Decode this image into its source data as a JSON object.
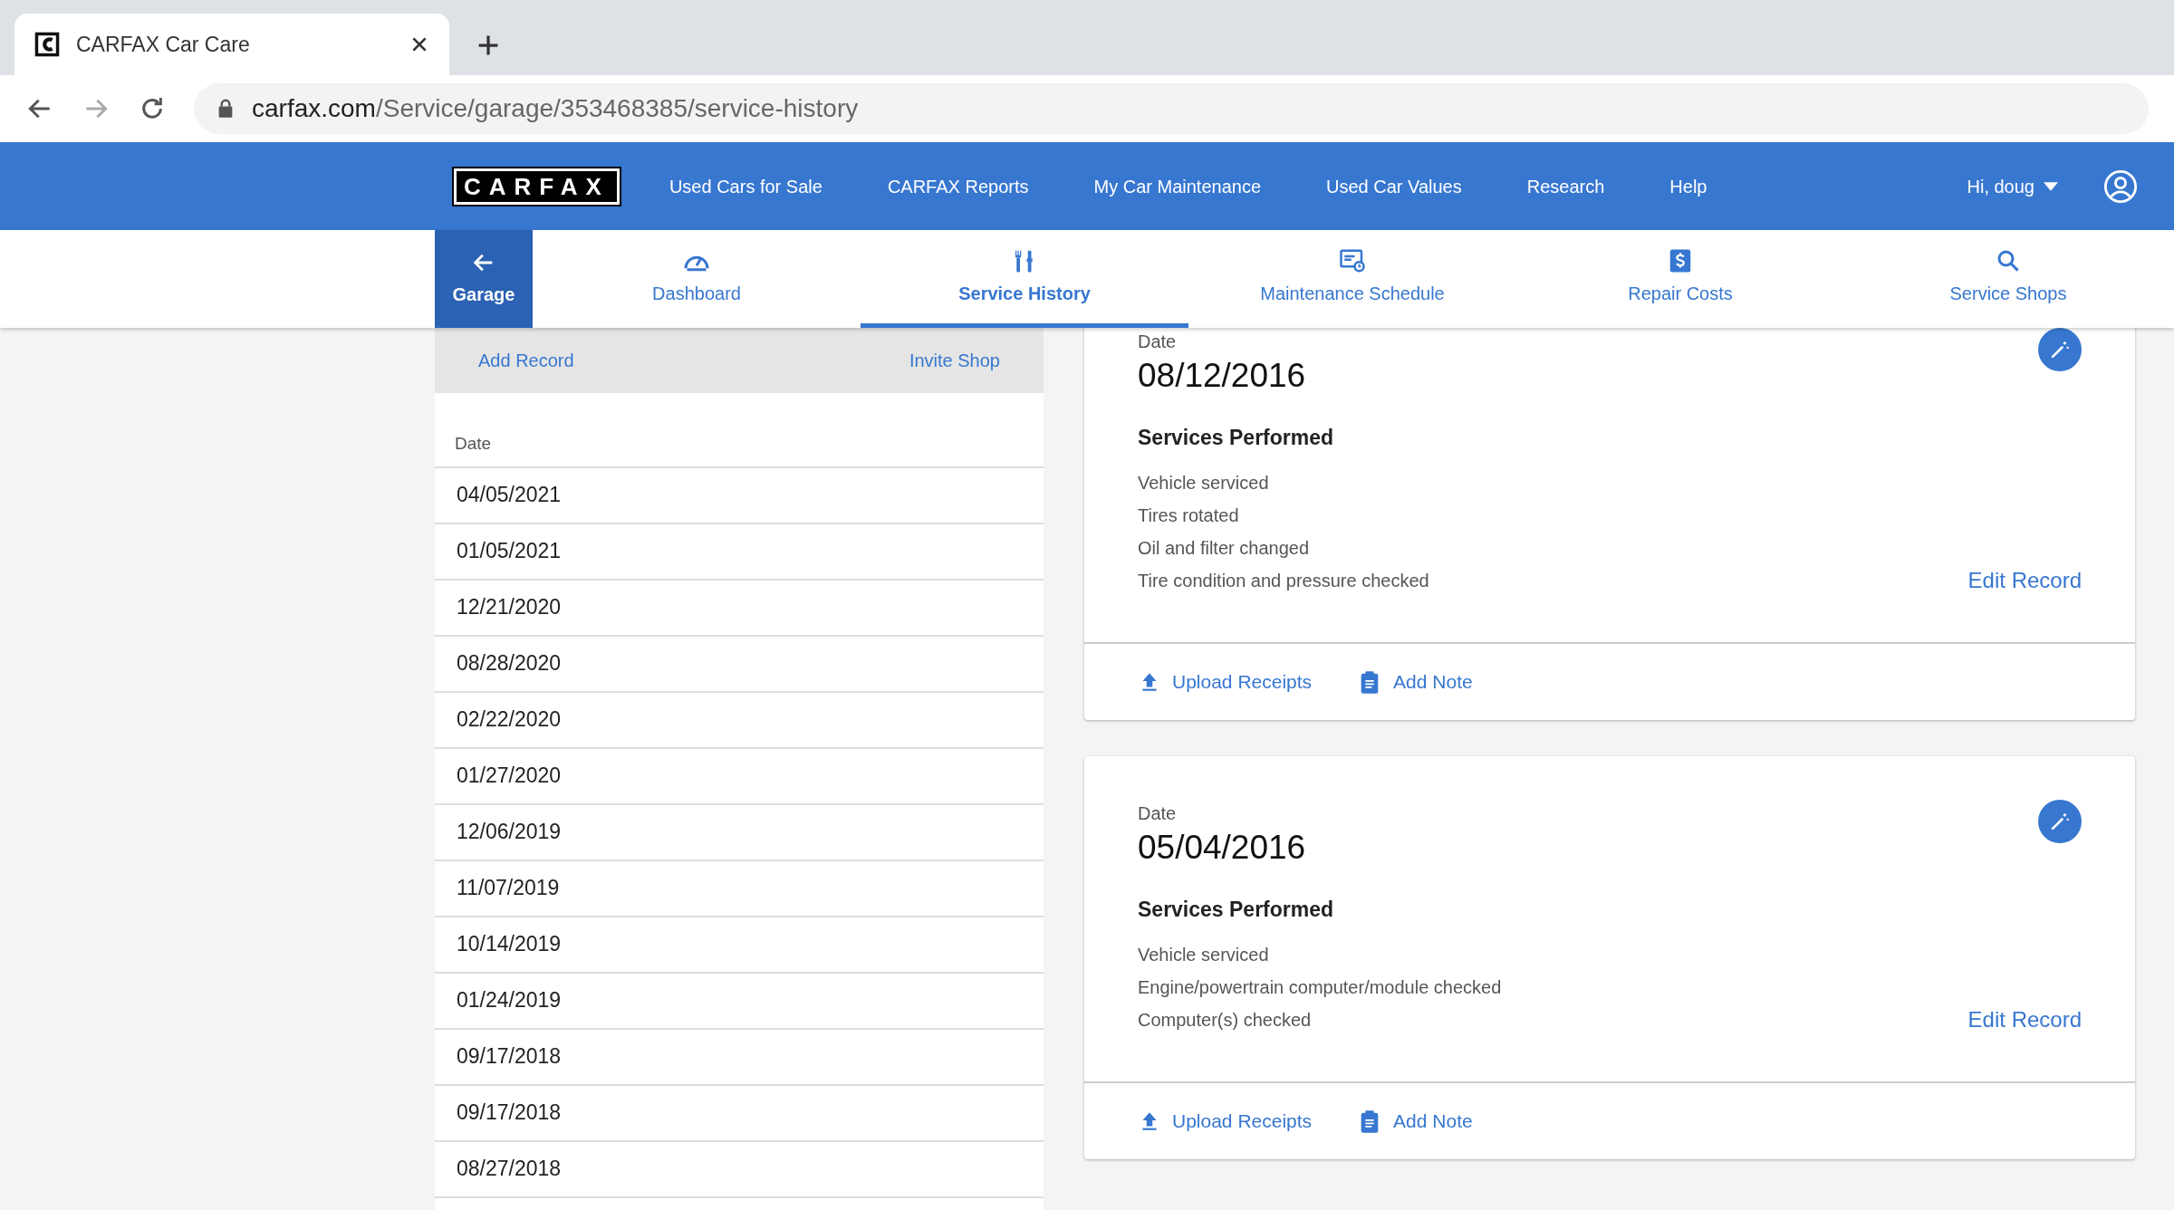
{
  "browser": {
    "tab_title": "CARFAX Car Care",
    "url_host": "carfax.com",
    "url_path": "/Service/garage/353468385/service-history"
  },
  "nav": {
    "logo": "CARFAX",
    "links": [
      "Used Cars for Sale",
      "CARFAX Reports",
      "My Car Maintenance",
      "Used Car Values",
      "Research",
      "Help"
    ],
    "user": "Hi, doug"
  },
  "subnav": {
    "back": "Garage",
    "tabs": [
      {
        "label": "Dashboard",
        "kind": "gauge",
        "selected": false
      },
      {
        "label": "Service History",
        "kind": "tools",
        "selected": true
      },
      {
        "label": "Maintenance Schedule",
        "kind": "schedule",
        "selected": false
      },
      {
        "label": "Repair Costs",
        "kind": "dollar",
        "selected": false
      },
      {
        "label": "Service Shops",
        "kind": "search",
        "selected": false
      }
    ]
  },
  "records_panel": {
    "actions": [
      "Add Record",
      "Invite Shop"
    ],
    "column": "Date",
    "rows": [
      "04/05/2021",
      "01/05/2021",
      "12/21/2020",
      "08/28/2020",
      "02/22/2020",
      "01/27/2020",
      "12/06/2019",
      "11/07/2019",
      "10/14/2019",
      "01/24/2019",
      "09/17/2018",
      "09/17/2018",
      "08/27/2018"
    ]
  },
  "records": [
    {
      "date_label": "Date",
      "date": "08/12/2016",
      "services_title": "Services Performed",
      "services": [
        "Vehicle serviced",
        "Tires rotated",
        "Oil and filter changed",
        "Tire condition and pressure checked"
      ],
      "edit": "Edit Record",
      "upload": "Upload Receipts",
      "note": "Add Note"
    },
    {
      "date_label": "Date",
      "date": "05/04/2016",
      "services_title": "Services Performed",
      "services": [
        "Vehicle serviced",
        "Engine/powertrain computer/module checked",
        "Computer(s) checked"
      ],
      "edit": "Edit Record",
      "upload": "Upload Receipts",
      "note": "Add Note"
    }
  ]
}
